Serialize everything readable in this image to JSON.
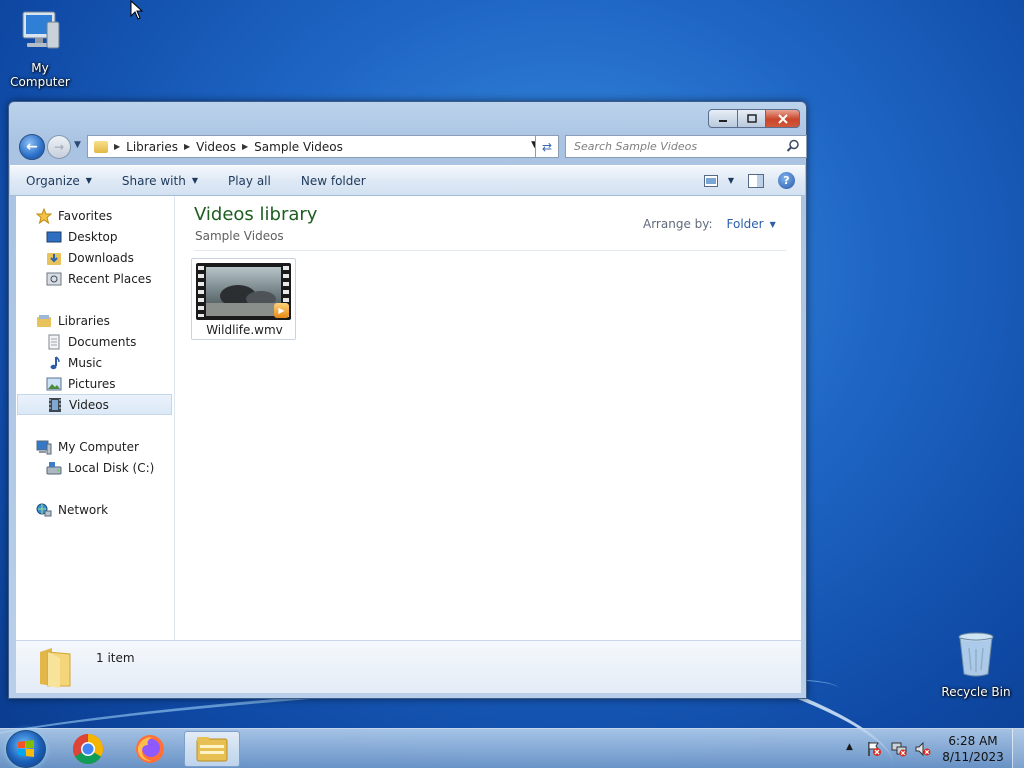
{
  "desktop": {
    "icons": [
      {
        "label": "My Computer"
      },
      {
        "label": "Recycle Bin"
      }
    ]
  },
  "window": {
    "address": {
      "crumbs": [
        "Libraries",
        "Videos",
        "Sample Videos"
      ]
    },
    "search": {
      "placeholder": "Search Sample Videos"
    },
    "toolbar": {
      "organize": "Organize",
      "share_with": "Share with",
      "play_all": "Play all",
      "new_folder": "New folder"
    },
    "navpane": {
      "favorites": "Favorites",
      "desktop": "Desktop",
      "downloads": "Downloads",
      "recent_places": "Recent Places",
      "libraries": "Libraries",
      "documents": "Documents",
      "music": "Music",
      "pictures": "Pictures",
      "videos": "Videos",
      "my_computer": "My Computer",
      "local_disk": "Local Disk (C:)",
      "network": "Network"
    },
    "main": {
      "title": "Videos library",
      "subtitle": "Sample Videos",
      "arrange_label": "Arrange by:",
      "arrange_value": "Folder",
      "files": [
        {
          "name": "Wildlife.wmv"
        }
      ]
    },
    "details": {
      "count": "1 item"
    }
  },
  "taskbar": {
    "clock_time": "6:28 AM",
    "clock_date": "8/11/2023"
  },
  "colors": {
    "library_title": "#1e5d20",
    "selection": "#dbe8f6",
    "link_blue": "#2b5ea8"
  }
}
